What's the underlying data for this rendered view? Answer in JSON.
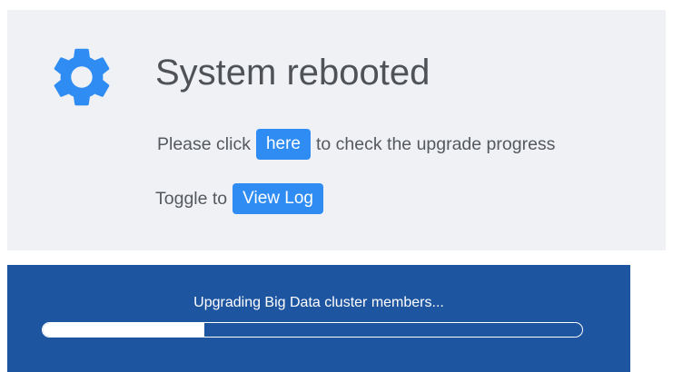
{
  "notice": {
    "icon": "gear-icon",
    "icon_color": "#2f8cf2",
    "title": "System rebooted",
    "line1_before": "Please click",
    "here_button": "here",
    "line1_after": "to check the upgrade progress",
    "line2_before": "Toggle to",
    "view_log_button": "View Log"
  },
  "progress": {
    "status_text": "Upgrading Big Data cluster members...",
    "percent": 30,
    "background_color": "#1e55a0"
  }
}
